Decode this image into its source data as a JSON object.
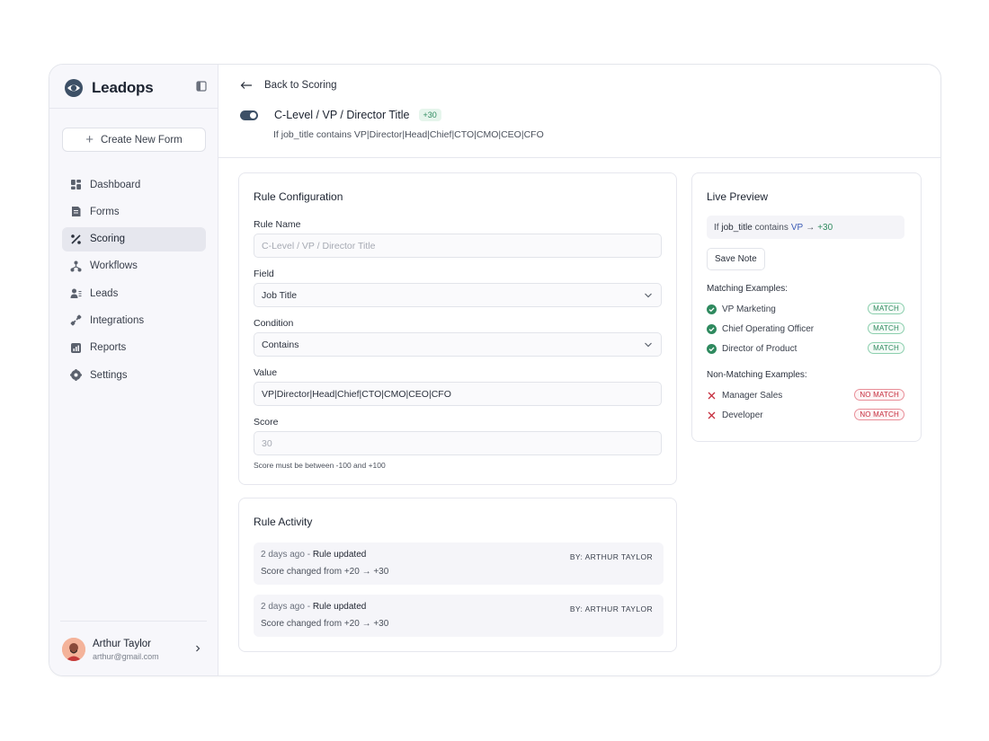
{
  "brand": {
    "name": "Leadops"
  },
  "sidebar": {
    "create_label": "Create New Form",
    "items": [
      {
        "label": "Dashboard",
        "icon": "dashboard-icon",
        "active": false
      },
      {
        "label": "Forms",
        "icon": "forms-icon",
        "active": false
      },
      {
        "label": "Scoring",
        "icon": "scoring-icon",
        "active": true
      },
      {
        "label": "Workflows",
        "icon": "workflows-icon",
        "active": false
      },
      {
        "label": "Leads",
        "icon": "leads-icon",
        "active": false
      },
      {
        "label": "Integrations",
        "icon": "integrations-icon",
        "active": false
      },
      {
        "label": "Reports",
        "icon": "reports-icon",
        "active": false
      },
      {
        "label": "Settings",
        "icon": "settings-icon",
        "active": false
      }
    ],
    "user": {
      "name": "Arthur Taylor",
      "email": "arthur@gmail.com"
    }
  },
  "header": {
    "back_label": "Back to Scoring",
    "rule_title": "C-Level / VP / Director Title",
    "rule_score": "+30",
    "rule_enabled": true,
    "rule_summary": "If job_title contains VP|Director|Head|Chief|CTO|CMO|CEO|CFO"
  },
  "config": {
    "title": "Rule Configuration",
    "rule_name_label": "Rule Name",
    "rule_name_placeholder": "C-Level / VP / Director Title",
    "field_label": "Field",
    "field_value": "Job Title",
    "condition_label": "Condition",
    "condition_value": "Contains",
    "value_label": "Value",
    "value_value": "VP|Director|Head|Chief|CTO|CMO|CEO|CFO",
    "score_label": "Score",
    "score_placeholder": "30",
    "help": "Score must be between -100 and +100"
  },
  "activity": {
    "title": "Rule Activity",
    "items": [
      {
        "time": "2 days ago",
        "action": "Rule updated",
        "by": "BY: ARTHUR TAYLOR",
        "detail": "Score changed from +20 → +30"
      },
      {
        "time": "2 days ago",
        "action": "Rule updated",
        "by": "BY: ARTHUR TAYLOR",
        "detail": "Score changed from +20 → +30"
      }
    ]
  },
  "preview": {
    "title": "Live Preview",
    "expr_if": "If",
    "expr_field": "job_title",
    "expr_op": "contains",
    "expr_value": "VP",
    "expr_arrow": "→",
    "expr_score": "+30",
    "save_note_label": "Save Note",
    "matching_label": "Matching Examples:",
    "matching": [
      {
        "text": "VP Marketing",
        "tag": "MATCH"
      },
      {
        "text": "Chief Operating Officer",
        "tag": "MATCH"
      },
      {
        "text": "Director of Product",
        "tag": "MATCH"
      }
    ],
    "nonmatching_label": "Non-Matching Examples:",
    "nonmatching": [
      {
        "text": "Manager Sales",
        "tag": "NO MATCH"
      },
      {
        "text": "Developer",
        "tag": "NO MATCH"
      }
    ]
  },
  "colors": {
    "accent_dark": "#3d5066",
    "match_green": "#2f8a5f",
    "nomatch_red": "#c62f3f",
    "value_blue": "#3b5bb5"
  }
}
